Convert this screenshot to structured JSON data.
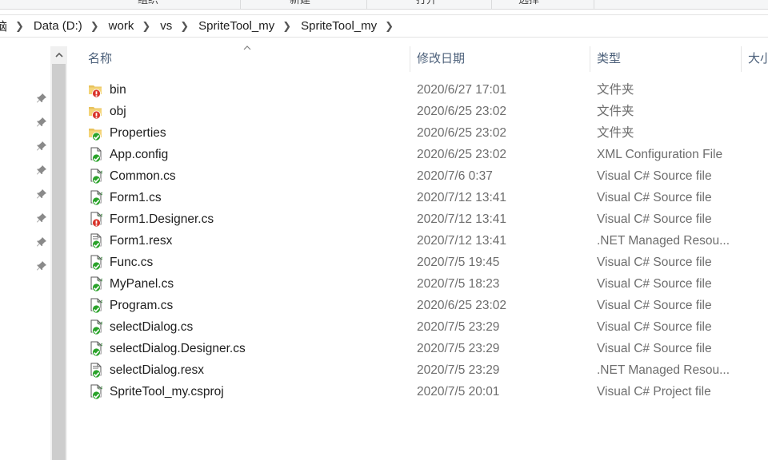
{
  "ribbon": {
    "labels": [
      "组织",
      "新建",
      "打开",
      "选择"
    ]
  },
  "breadcrumb": {
    "items": [
      "脑",
      "Data (D:)",
      "work",
      "vs",
      "SpriteTool_my",
      "SpriteTool_my"
    ]
  },
  "columns": {
    "name": "名称",
    "date": "修改日期",
    "type": "类型",
    "size": "大小"
  },
  "files": [
    {
      "name": "bin",
      "date": "2020/6/27 17:01",
      "type": "文件夹",
      "icon": "folder-icon",
      "status": "conflict"
    },
    {
      "name": "obj",
      "date": "2020/6/25 23:02",
      "type": "文件夹",
      "icon": "folder-icon",
      "status": "conflict"
    },
    {
      "name": "Properties",
      "date": "2020/6/25 23:02",
      "type": "文件夹",
      "icon": "folder-icon",
      "status": "ok"
    },
    {
      "name": "App.config",
      "date": "2020/6/25 23:02",
      "type": "XML Configuration File",
      "icon": "config-file-icon",
      "status": "ok"
    },
    {
      "name": "Common.cs",
      "date": "2020/7/6 0:37",
      "type": "Visual C# Source file",
      "icon": "csharp-file-icon",
      "status": "ok"
    },
    {
      "name": "Form1.cs",
      "date": "2020/7/12 13:41",
      "type": "Visual C# Source file",
      "icon": "csharp-file-icon",
      "status": "ok"
    },
    {
      "name": "Form1.Designer.cs",
      "date": "2020/7/12 13:41",
      "type": "Visual C# Source file",
      "icon": "csharp-file-icon",
      "status": "conflict"
    },
    {
      "name": "Form1.resx",
      "date": "2020/7/12 13:41",
      "type": ".NET Managed Resou...",
      "icon": "resx-file-icon",
      "status": "ok"
    },
    {
      "name": "Func.cs",
      "date": "2020/7/5 19:45",
      "type": "Visual C# Source file",
      "icon": "csharp-file-icon",
      "status": "ok"
    },
    {
      "name": "MyPanel.cs",
      "date": "2020/7/5 18:23",
      "type": "Visual C# Source file",
      "icon": "csharp-file-icon",
      "status": "ok"
    },
    {
      "name": "Program.cs",
      "date": "2020/6/25 23:02",
      "type": "Visual C# Source file",
      "icon": "csharp-file-icon",
      "status": "ok"
    },
    {
      "name": "selectDialog.cs",
      "date": "2020/7/5 23:29",
      "type": "Visual C# Source file",
      "icon": "csharp-file-icon",
      "status": "ok"
    },
    {
      "name": "selectDialog.Designer.cs",
      "date": "2020/7/5 23:29",
      "type": "Visual C# Source file",
      "icon": "csharp-file-icon",
      "status": "ok"
    },
    {
      "name": "selectDialog.resx",
      "date": "2020/7/5 23:29",
      "type": ".NET Managed Resou...",
      "icon": "resx-file-icon",
      "status": "ok"
    },
    {
      "name": "SpriteTool_my.csproj",
      "date": "2020/7/5 20:01",
      "type": "Visual C# Project file",
      "icon": "csproj-file-icon",
      "status": "ok"
    }
  ],
  "colors": {
    "header_text": "#4c607a",
    "ok_badge": "#2aa32a",
    "conflict_badge": "#d9342b",
    "folder": "#e8c25c",
    "secondary_text": "#6d6d6d"
  }
}
